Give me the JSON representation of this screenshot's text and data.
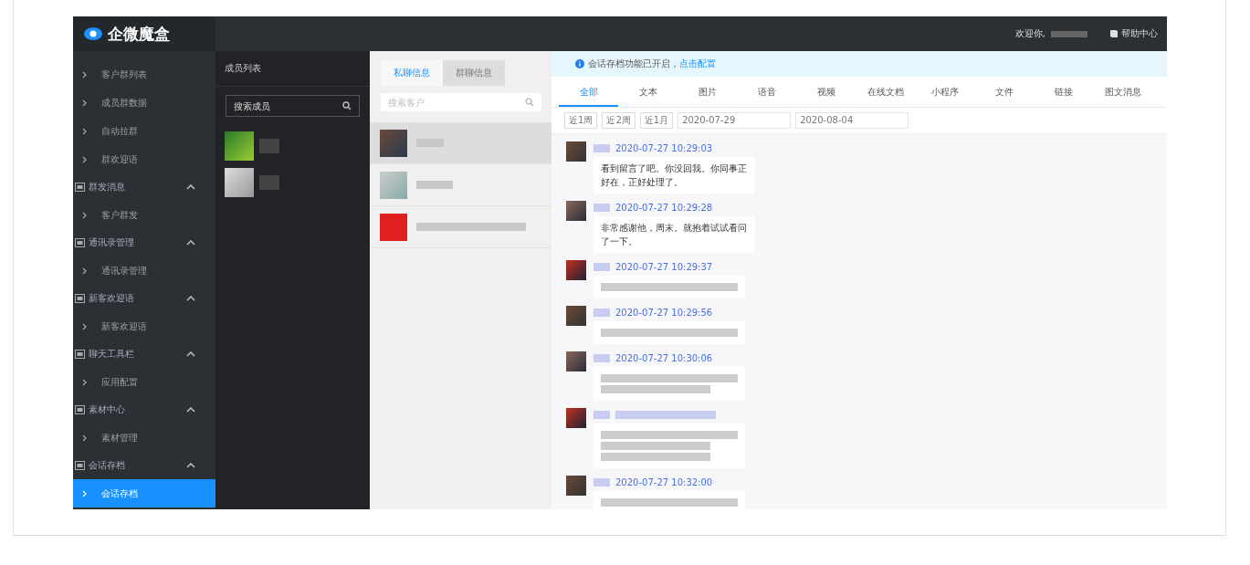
{
  "logo": {
    "text": "企微魔盒"
  },
  "topbar": {
    "welcome": "欢迎你,",
    "help": "帮助中心"
  },
  "sidebar": {
    "items": [
      {
        "kind": "child",
        "label": "客户群列表",
        "selected": false
      },
      {
        "kind": "child",
        "label": "成员群数据",
        "selected": false
      },
      {
        "kind": "child",
        "label": "自动拉群",
        "selected": false
      },
      {
        "kind": "child",
        "label": "群欢迎语",
        "selected": false
      },
      {
        "kind": "group",
        "label": "群发消息",
        "expanded": true,
        "children": [
          {
            "label": "客户群发",
            "selected": false
          }
        ]
      },
      {
        "kind": "group",
        "label": "通讯录管理",
        "expanded": true,
        "children": [
          {
            "label": "通讯录管理",
            "selected": false
          }
        ]
      },
      {
        "kind": "group",
        "label": "新客欢迎语",
        "expanded": true,
        "children": [
          {
            "label": "新客欢迎语",
            "selected": false
          }
        ]
      },
      {
        "kind": "group",
        "label": "聊天工具栏",
        "expanded": true,
        "children": [
          {
            "label": "应用配置",
            "selected": false
          }
        ]
      },
      {
        "kind": "group",
        "label": "素材中心",
        "expanded": true,
        "children": [
          {
            "label": "素材管理",
            "selected": false
          }
        ]
      },
      {
        "kind": "group",
        "label": "会话存档",
        "expanded": true,
        "children": [
          {
            "label": "会话存档",
            "selected": true
          }
        ]
      }
    ]
  },
  "members": {
    "title": "成员列表",
    "search": {
      "placeholder": "搜索成员"
    }
  },
  "customers": {
    "tabs": [
      {
        "label": "私聊信息",
        "selected": true
      },
      {
        "label": "群聊信息",
        "selected": false
      }
    ],
    "search": {
      "placeholder": "搜索客户"
    },
    "rows": [
      {
        "selected": true
      },
      {
        "selected": false
      },
      {
        "selected": false
      }
    ]
  },
  "notice": {
    "text": "会话存档功能已开启，",
    "link": "点击配置"
  },
  "type_tabs": [
    {
      "label": "全部",
      "selected": true
    },
    {
      "label": "文本",
      "selected": false
    },
    {
      "label": "图片",
      "selected": false
    },
    {
      "label": "语音",
      "selected": false
    },
    {
      "label": "视频",
      "selected": false
    },
    {
      "label": "在线文档",
      "selected": false
    },
    {
      "label": "小程序",
      "selected": false
    },
    {
      "label": "文件",
      "selected": false
    },
    {
      "label": "链接",
      "selected": false
    },
    {
      "label": "图文消息",
      "selected": false
    }
  ],
  "date_filter": {
    "ranges": [
      "近1周",
      "近2周",
      "近1月"
    ],
    "start": "2020-07-29",
    "end": "2020-08-04"
  },
  "messages": [
    {
      "time": "2020-07-27 10:29:03",
      "kind": "text",
      "text": "看到留言了吧。你没回我。你同事正好在，正好处理了。"
    },
    {
      "time": "2020-07-27 10:29:28",
      "kind": "text",
      "text": "非常感谢他，周末。就抱着试试看问了一下。"
    },
    {
      "time": "2020-07-27 10:29:37",
      "kind": "redacted"
    },
    {
      "time": "2020-07-27 10:29:56",
      "kind": "redacted"
    },
    {
      "time": "2020-07-27 10:30:06",
      "kind": "redacted"
    },
    {
      "kind": "redacted"
    },
    {
      "time": "2020-07-27 10:32:00",
      "kind": "redacted"
    }
  ]
}
